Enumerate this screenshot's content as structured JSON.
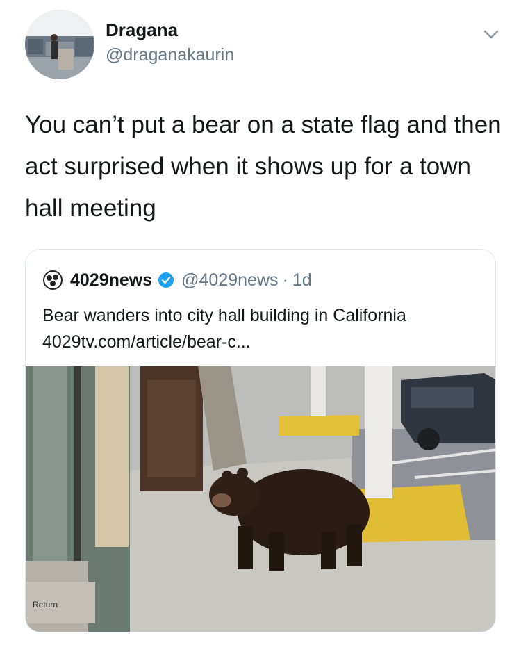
{
  "tweet": {
    "author": {
      "display_name": "Dragana",
      "handle": "@draganakaurin",
      "avatar_icon": "avatar-photo-icon"
    },
    "menu_icon": "chevron-down-icon",
    "text": "You can’t put a bear on a state flag and then act surprised when it shows up for a town hall meeting"
  },
  "quoted_tweet": {
    "logo_icon": "4029news-logo-icon",
    "name": "4029news",
    "verified_icon": "verified-badge-icon",
    "handle": "@4029news",
    "separator": "·",
    "time": "1d",
    "text_line_1": "Bear wanders into city hall building in California",
    "text_line_2": "4029tv.com/article/bear-c...",
    "media": {
      "description_icon": "bear-photo-icon",
      "sign_text": "Return"
    }
  },
  "colors": {
    "text_primary": "#14171a",
    "text_secondary": "#657786",
    "verified_blue": "#1da1f2",
    "border": "#e1e8ed"
  }
}
